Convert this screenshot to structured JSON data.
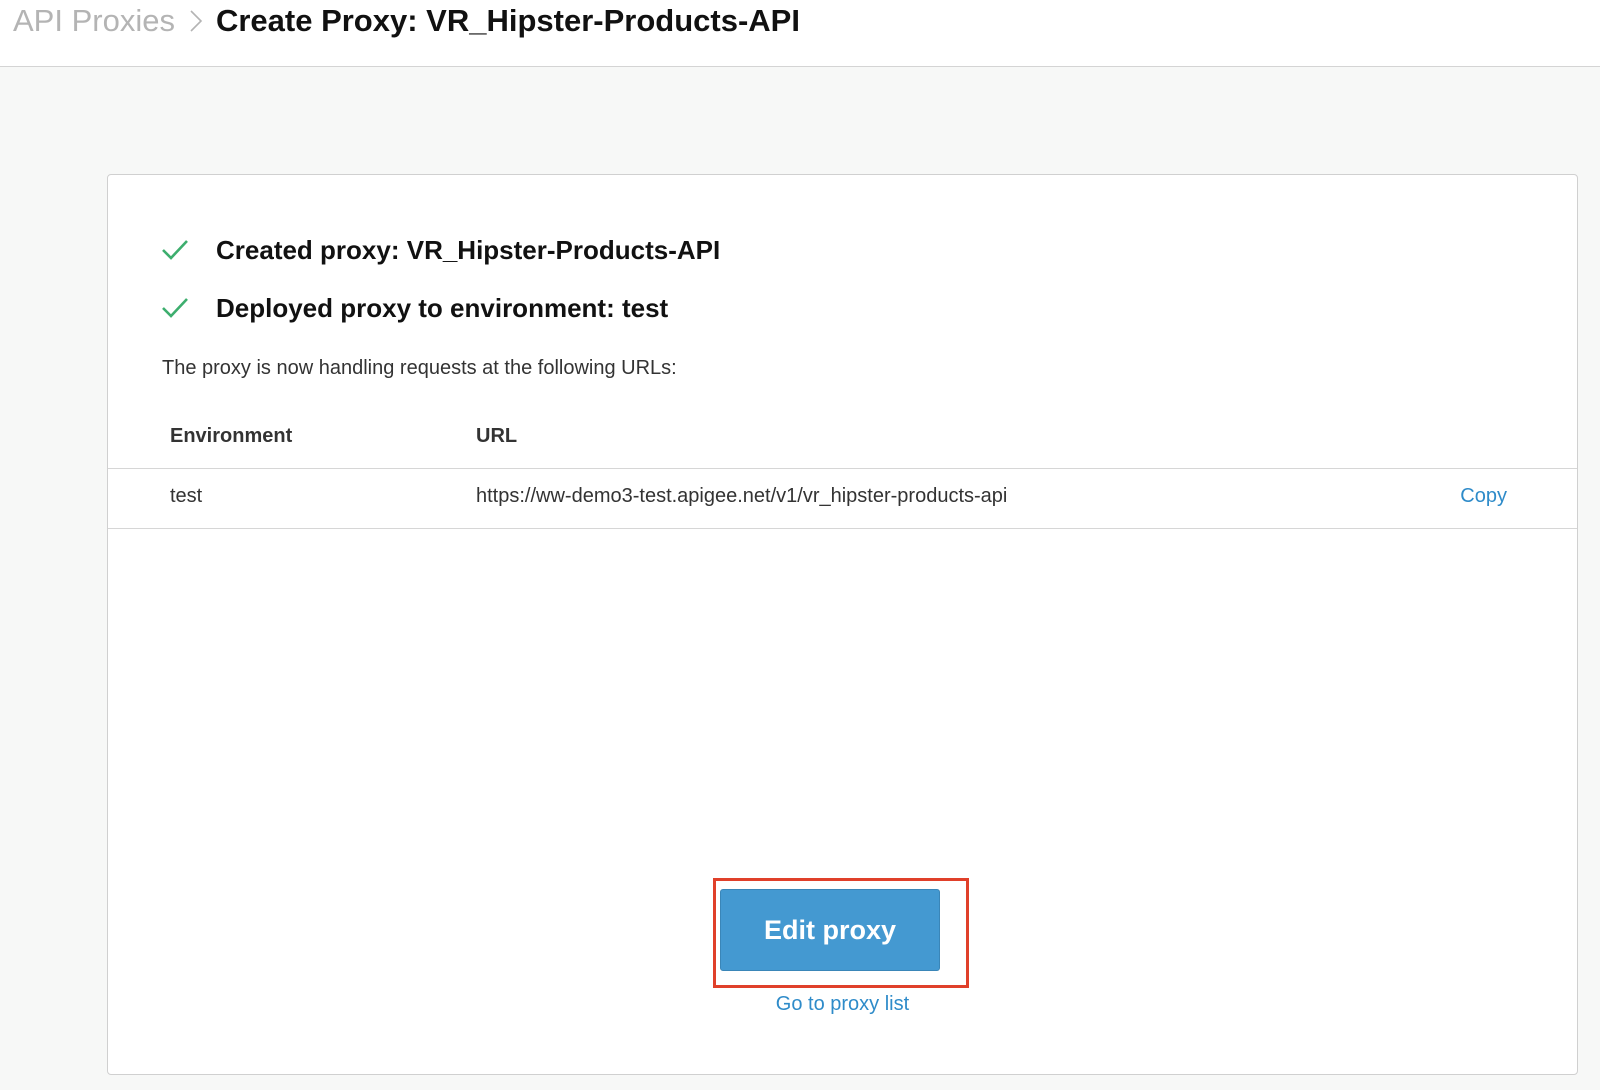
{
  "header": {
    "breadcrumb_parent": "API Proxies",
    "title": "Create Proxy: VR_Hipster-Products-API",
    "separator_icon": "chevron-right-icon"
  },
  "status": {
    "items": [
      {
        "icon": "check-icon",
        "text": "Created proxy: VR_Hipster-Products-API"
      },
      {
        "icon": "check-icon",
        "text": "Deployed proxy to environment: test"
      }
    ],
    "info_text": "The proxy is now handling requests at the following URLs:"
  },
  "table": {
    "headers": {
      "environment": "Environment",
      "url": "URL"
    },
    "rows": [
      {
        "environment": "test",
        "url": "https://ww-demo3-test.apigee.net/v1/vr_hipster-products-api",
        "action": "Copy"
      }
    ]
  },
  "actions": {
    "edit_label": "Edit proxy",
    "proxy_list_link": "Go to proxy list"
  },
  "colors": {
    "check": "#3dae6e",
    "link": "#2e8bc9",
    "primary_button": "#4499d1",
    "highlight_frame": "#e0402a"
  }
}
